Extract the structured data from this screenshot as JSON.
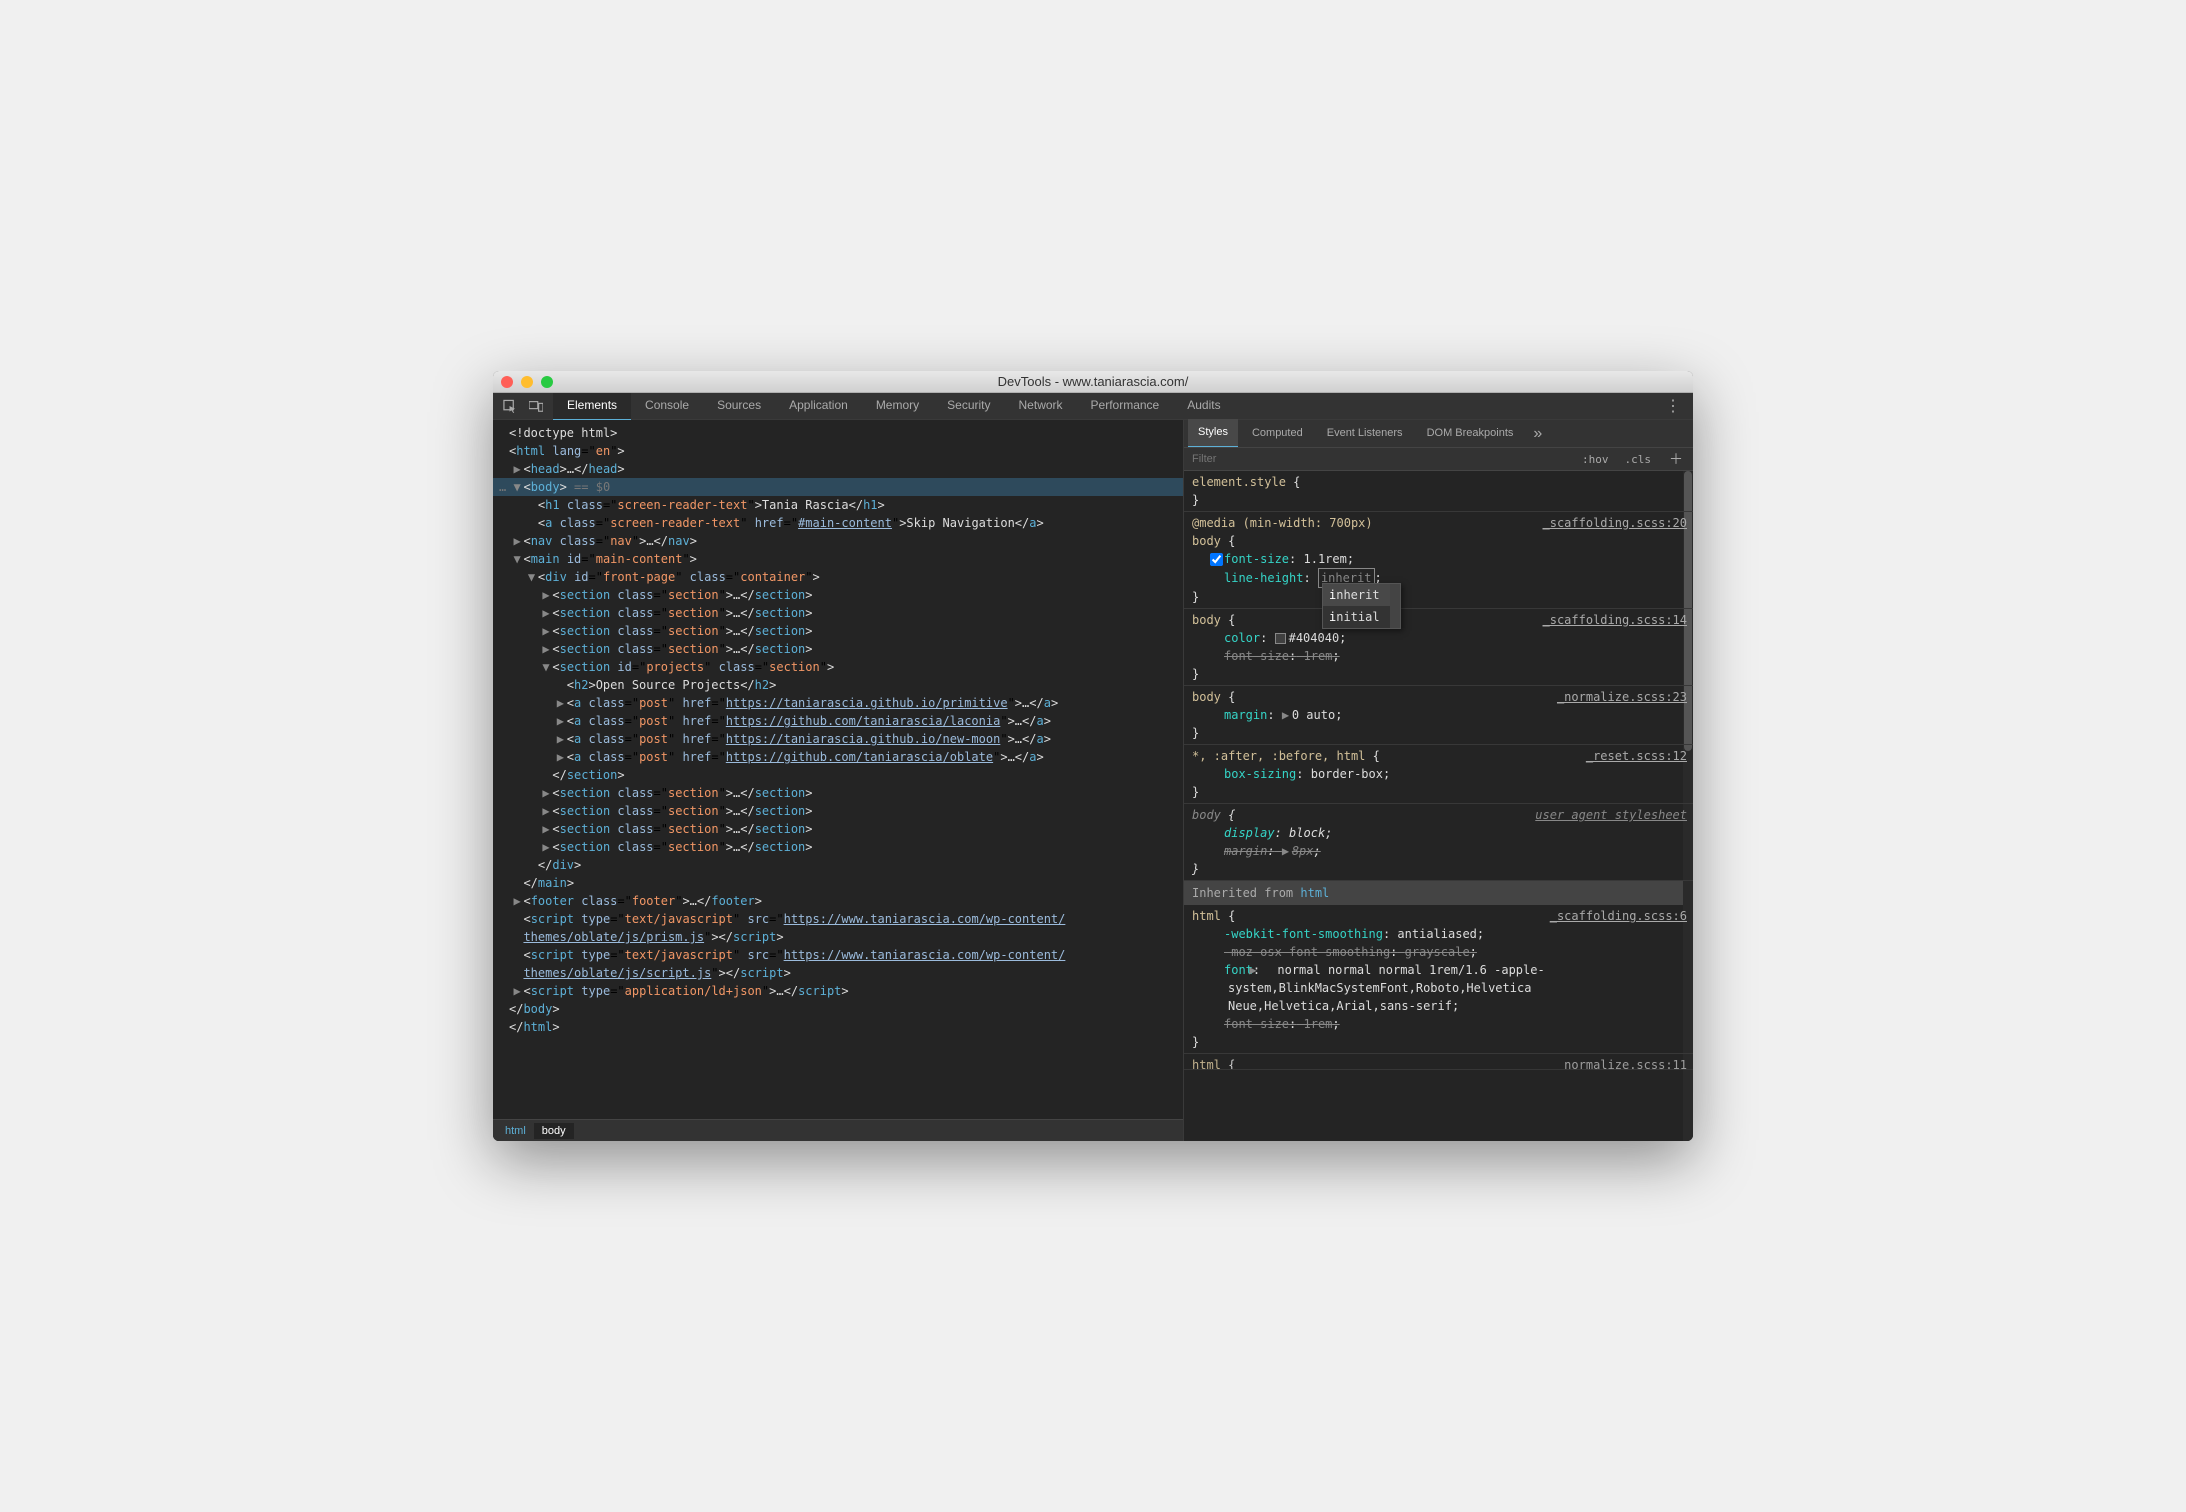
{
  "window": {
    "title": "DevTools - www.taniarascia.com/"
  },
  "toolbar": {
    "tabs": [
      "Elements",
      "Console",
      "Sources",
      "Application",
      "Memory",
      "Security",
      "Network",
      "Performance",
      "Audits"
    ],
    "active": 0
  },
  "dom": {
    "lines": [
      {
        "indent": 0,
        "arrow": "",
        "html": "<span class='txt'>&lt;!doctype html&gt;</span>"
      },
      {
        "indent": 0,
        "arrow": "",
        "html": "<span class='txt'>&lt;</span><span class='tag'>html</span> <span class='attr'>lang</span>=\"<span class='str'>en</span>\"<span class='txt'>&gt;</span>"
      },
      {
        "indent": 1,
        "arrow": "▶",
        "html": "<span class='txt'>&lt;</span><span class='tag'>head</span><span class='txt'>&gt;…&lt;/</span><span class='tag'>head</span><span class='txt'>&gt;</span>"
      },
      {
        "indent": 0,
        "arrow": "▼",
        "sel": true,
        "prefix": "… ",
        "html": "<span class='txt'>&lt;</span><span class='tag'>body</span><span class='txt'>&gt;</span><span class='dim'> == $0</span>"
      },
      {
        "indent": 2,
        "arrow": "",
        "html": "<span class='txt'>&lt;</span><span class='tag'>h1</span> <span class='attr'>class</span>=\"<span class='str'>screen-reader-text</span>\"<span class='txt'>&gt;Tania Rascia&lt;/</span><span class='tag'>h1</span><span class='txt'>&gt;</span>"
      },
      {
        "indent": 2,
        "arrow": "",
        "html": "<span class='txt'>&lt;</span><span class='tag'>a</span> <span class='attr'>class</span>=\"<span class='str'>screen-reader-text</span>\" <span class='attr'>href</span>=\"<span class='lnk'>#main-content</span>\"<span class='txt'>&gt;Skip Navigation&lt;/</span><span class='tag'>a</span><span class='txt'>&gt;</span>"
      },
      {
        "indent": 1,
        "arrow": "▶",
        "html": "<span class='txt'>&lt;</span><span class='tag'>nav</span> <span class='attr'>class</span>=\"<span class='str'>nav</span>\"<span class='txt'>&gt;…&lt;/</span><span class='tag'>nav</span><span class='txt'>&gt;</span>"
      },
      {
        "indent": 1,
        "arrow": "▼",
        "html": "<span class='txt'>&lt;</span><span class='tag'>main</span> <span class='attr'>id</span>=\"<span class='str'>main-content</span>\"<span class='txt'>&gt;</span>"
      },
      {
        "indent": 2,
        "arrow": "▼",
        "html": "<span class='txt'>&lt;</span><span class='tag'>div</span> <span class='attr'>id</span>=\"<span class='str'>front-page</span>\" <span class='attr'>class</span>=\"<span class='str'>container</span>\"<span class='txt'>&gt;</span>"
      },
      {
        "indent": 3,
        "arrow": "▶",
        "html": "<span class='txt'>&lt;</span><span class='tag'>section</span> <span class='attr'>class</span>=\"<span class='str'>section</span>\"<span class='txt'>&gt;…&lt;/</span><span class='tag'>section</span><span class='txt'>&gt;</span>"
      },
      {
        "indent": 3,
        "arrow": "▶",
        "html": "<span class='txt'>&lt;</span><span class='tag'>section</span> <span class='attr'>class</span>=\"<span class='str'>section</span>\"<span class='txt'>&gt;…&lt;/</span><span class='tag'>section</span><span class='txt'>&gt;</span>"
      },
      {
        "indent": 3,
        "arrow": "▶",
        "html": "<span class='txt'>&lt;</span><span class='tag'>section</span> <span class='attr'>class</span>=\"<span class='str'>section</span>\"<span class='txt'>&gt;…&lt;/</span><span class='tag'>section</span><span class='txt'>&gt;</span>"
      },
      {
        "indent": 3,
        "arrow": "▶",
        "html": "<span class='txt'>&lt;</span><span class='tag'>section</span> <span class='attr'>class</span>=\"<span class='str'>section</span>\"<span class='txt'>&gt;…&lt;/</span><span class='tag'>section</span><span class='txt'>&gt;</span>"
      },
      {
        "indent": 3,
        "arrow": "▼",
        "html": "<span class='txt'>&lt;</span><span class='tag'>section</span> <span class='attr'>id</span>=\"<span class='str'>projects</span>\" <span class='attr'>class</span>=\"<span class='str'>section</span>\"<span class='txt'>&gt;</span>"
      },
      {
        "indent": 4,
        "arrow": "",
        "html": "<span class='txt'>&lt;</span><span class='tag'>h2</span><span class='txt'>&gt;Open Source Projects&lt;/</span><span class='tag'>h2</span><span class='txt'>&gt;</span>"
      },
      {
        "indent": 4,
        "arrow": "▶",
        "html": "<span class='txt'>&lt;</span><span class='tag'>a</span> <span class='attr'>class</span>=\"<span class='str'>post</span>\" <span class='attr'>href</span>=\"<span class='lnk'>https://taniarascia.github.io/primitive</span>\"<span class='txt'>&gt;…&lt;/</span><span class='tag'>a</span><span class='txt'>&gt;</span>"
      },
      {
        "indent": 4,
        "arrow": "▶",
        "html": "<span class='txt'>&lt;</span><span class='tag'>a</span> <span class='attr'>class</span>=\"<span class='str'>post</span>\" <span class='attr'>href</span>=\"<span class='lnk'>https://github.com/taniarascia/laconia</span>\"<span class='txt'>&gt;…&lt;/</span><span class='tag'>a</span><span class='txt'>&gt;</span>"
      },
      {
        "indent": 4,
        "arrow": "▶",
        "html": "<span class='txt'>&lt;</span><span class='tag'>a</span> <span class='attr'>class</span>=\"<span class='str'>post</span>\" <span class='attr'>href</span>=\"<span class='lnk'>https://taniarascia.github.io/new-moon</span>\"<span class='txt'>&gt;…&lt;/</span><span class='tag'>a</span><span class='txt'>&gt;</span>"
      },
      {
        "indent": 4,
        "arrow": "▶",
        "html": "<span class='txt'>&lt;</span><span class='tag'>a</span> <span class='attr'>class</span>=\"<span class='str'>post</span>\" <span class='attr'>href</span>=\"<span class='lnk'>https://github.com/taniarascia/oblate</span>\"<span class='txt'>&gt;…&lt;/</span><span class='tag'>a</span><span class='txt'>&gt;</span>"
      },
      {
        "indent": 3,
        "arrow": "",
        "html": "<span class='txt'>&lt;/</span><span class='tag'>section</span><span class='txt'>&gt;</span>"
      },
      {
        "indent": 3,
        "arrow": "▶",
        "html": "<span class='txt'>&lt;</span><span class='tag'>section</span> <span class='attr'>class</span>=\"<span class='str'>section</span>\"<span class='txt'>&gt;…&lt;/</span><span class='tag'>section</span><span class='txt'>&gt;</span>"
      },
      {
        "indent": 3,
        "arrow": "▶",
        "html": "<span class='txt'>&lt;</span><span class='tag'>section</span> <span class='attr'>class</span>=\"<span class='str'>section</span>\"<span class='txt'>&gt;…&lt;/</span><span class='tag'>section</span><span class='txt'>&gt;</span>"
      },
      {
        "indent": 3,
        "arrow": "▶",
        "html": "<span class='txt'>&lt;</span><span class='tag'>section</span> <span class='attr'>class</span>=\"<span class='str'>section</span>\"<span class='txt'>&gt;…&lt;/</span><span class='tag'>section</span><span class='txt'>&gt;</span>"
      },
      {
        "indent": 3,
        "arrow": "▶",
        "html": "<span class='txt'>&lt;</span><span class='tag'>section</span> <span class='attr'>class</span>=\"<span class='str'>section</span>\"<span class='txt'>&gt;…&lt;/</span><span class='tag'>section</span><span class='txt'>&gt;</span>"
      },
      {
        "indent": 2,
        "arrow": "",
        "html": "<span class='txt'>&lt;/</span><span class='tag'>div</span><span class='txt'>&gt;</span>"
      },
      {
        "indent": 1,
        "arrow": "",
        "html": "<span class='txt'>&lt;/</span><span class='tag'>main</span><span class='txt'>&gt;</span>"
      },
      {
        "indent": 1,
        "arrow": "▶",
        "html": "<span class='txt'>&lt;</span><span class='tag'>footer</span> <span class='attr'>class</span>=\"<span class='str'>footer</span>\"<span class='txt'>&gt;…&lt;/</span><span class='tag'>footer</span><span class='txt'>&gt;</span>"
      },
      {
        "indent": 1,
        "arrow": "",
        "html": "<span class='txt'>&lt;</span><span class='tag'>script</span> <span class='attr'>type</span>=\"<span class='str'>text/javascript</span>\" <span class='attr'>src</span>=\"<span class='lnk'>https://www.taniarascia.com/wp-content/</span>"
      },
      {
        "indent": 1,
        "arrow": "",
        "cont": true,
        "html": "<span class='lnk'>themes/oblate/js/prism.js</span>\"<span class='txt'>&gt;&lt;/</span><span class='tag'>script</span><span class='txt'>&gt;</span>"
      },
      {
        "indent": 1,
        "arrow": "",
        "html": "<span class='txt'>&lt;</span><span class='tag'>script</span> <span class='attr'>type</span>=\"<span class='str'>text/javascript</span>\" <span class='attr'>src</span>=\"<span class='lnk'>https://www.taniarascia.com/wp-content/</span>"
      },
      {
        "indent": 1,
        "arrow": "",
        "cont": true,
        "html": "<span class='lnk'>themes/oblate/js/script.js</span>\"<span class='txt'>&gt;&lt;/</span><span class='tag'>script</span><span class='txt'>&gt;</span>"
      },
      {
        "indent": 1,
        "arrow": "▶",
        "html": "<span class='txt'>&lt;</span><span class='tag'>script</span> <span class='attr'>type</span>=\"<span class='str'>application/ld+json</span>\"<span class='txt'>&gt;…&lt;/</span><span class='tag'>script</span><span class='txt'>&gt;</span>"
      },
      {
        "indent": 0,
        "arrow": "",
        "html": "<span class='txt'>&lt;/</span><span class='tag'>body</span><span class='txt'>&gt;</span>"
      },
      {
        "indent": 0,
        "arrow": "",
        "html": "<span class='txt'>&lt;/</span><span class='tag'>html</span><span class='txt'>&gt;</span>"
      }
    ]
  },
  "breadcrumbs": [
    "html",
    "body"
  ],
  "styles": {
    "tabs": [
      "Styles",
      "Computed",
      "Event Listeners",
      "DOM Breakpoints"
    ],
    "active": 0,
    "filter_placeholder": "Filter",
    "hov": ":hov",
    "cls": ".cls",
    "editing_value": "inherit",
    "suggestions": [
      "inherit",
      "initial"
    ],
    "inherit_label": "Inherited from ",
    "inherit_target": "html",
    "rules": [
      {
        "selector": "element.style",
        "src": "",
        "decls": []
      },
      {
        "media": "@media (min-width: 700px)",
        "selector": "body",
        "src": "_scaffolding.scss:20",
        "decls": [
          {
            "checked": true,
            "prop": "font-size",
            "val": "1.1rem"
          },
          {
            "prop": "line-height",
            "editing": true
          }
        ]
      },
      {
        "selector": "body",
        "src": "_scaffolding.scss:14",
        "decls": [
          {
            "prop": "color",
            "val": "#404040",
            "swatch": "#404040"
          },
          {
            "prop": "font-size",
            "val": "1rem",
            "strike": true
          }
        ]
      },
      {
        "selector": "body",
        "src": "_normalize.scss:23",
        "decls": [
          {
            "prop": "margin",
            "val": "0 auto",
            "expand": true
          }
        ]
      },
      {
        "selector": "*, :after, :before, html",
        "src": "_reset.scss:12",
        "decls": [
          {
            "prop": "box-sizing",
            "val": "border-box"
          }
        ]
      },
      {
        "selector": "body",
        "src": "user agent stylesheet",
        "ua": true,
        "decls": [
          {
            "prop": "display",
            "val": "block"
          },
          {
            "prop": "margin",
            "val": "8px",
            "strike": true,
            "expand": true
          }
        ]
      },
      {
        "header": "inherit"
      },
      {
        "selector": "html",
        "src": "_scaffolding.scss:6",
        "decls": [
          {
            "prop": "-webkit-font-smoothing",
            "val": "antialiased"
          },
          {
            "prop": "-moz-osx-font-smoothing",
            "val": "grayscale",
            "strike": true
          },
          {
            "prop": "font",
            "val": "normal normal normal 1rem/1.6 -apple-system,BlinkMacSystemFont,Roboto,Helvetica Neue,Helvetica,Arial,sans-serif",
            "expand": true,
            "wrap": true
          },
          {
            "prop": "font-size",
            "val": "1rem",
            "strike": true
          }
        ]
      },
      {
        "selector": "html",
        "src": "normalize.scss:11",
        "cut": true,
        "decls": []
      }
    ]
  }
}
